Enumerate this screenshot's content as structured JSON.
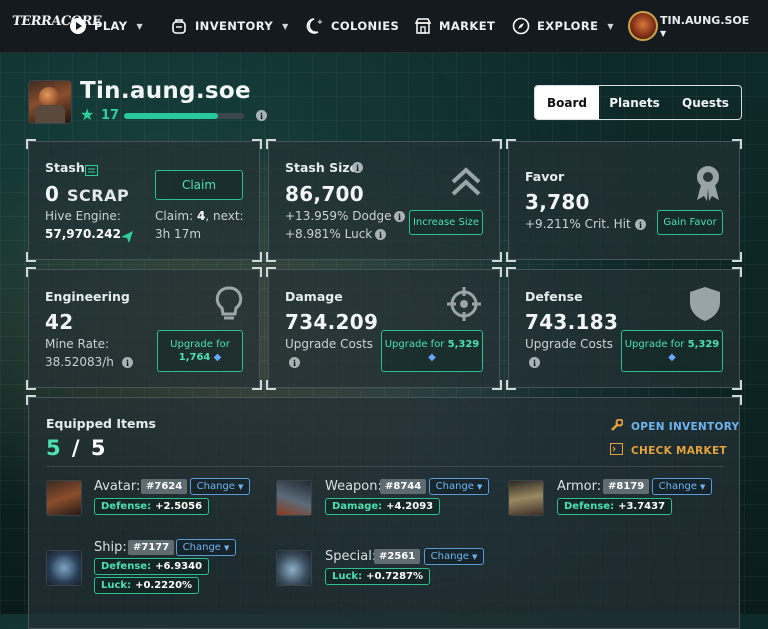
{
  "nav": {
    "logo": "TERRACORE",
    "play": "PLAY",
    "inventory": "INVENTORY",
    "colonies": "COLONIES",
    "market": "MARKET",
    "explore": "EXPLORE",
    "username": "TIN.AUNG.SOE"
  },
  "profile": {
    "name": "Tin.aung.soe",
    "level": "17",
    "xp_progress": 0.78
  },
  "tabs": [
    "Board",
    "Planets",
    "Quests"
  ],
  "stash": {
    "title": "Stash",
    "value": "0",
    "unit": "SCRAP",
    "engine_label": "Hive Engine:",
    "engine_value": "57,970.242",
    "claim_button": "Claim",
    "claim_label": "Claim:",
    "claim_count": "4",
    "next_label": ", next:",
    "next_time": "3h 17m"
  },
  "stash_size": {
    "title": "Stash Size",
    "value": "86,700",
    "dodge": "+13.959% Dodge",
    "luck": "+8.981% Luck",
    "button": "Increase Size"
  },
  "favor": {
    "title": "Favor",
    "value": "3,780",
    "crit": "+9.211% Crit. Hit",
    "button": "Gain Favor"
  },
  "engineering": {
    "title": "Engineering",
    "value": "42",
    "rate_label": "Mine Rate:",
    "rate_value": "38.52083/h",
    "button_text": "Upgrade for",
    "button_cost": "1,764"
  },
  "damage": {
    "title": "Damage",
    "value": "734.209",
    "costs_label": "Upgrade Costs",
    "button_text": "Upgrade for",
    "button_cost": "5,329"
  },
  "defense": {
    "title": "Defense",
    "value": "743.183",
    "costs_label": "Upgrade Costs",
    "button_text": "Upgrade for",
    "button_cost": "5,329"
  },
  "equipped": {
    "title": "Equipped Items",
    "count": "5",
    "total": "5",
    "open_inventory": "OPEN INVENTORY",
    "check_market": "CHECK MARKET",
    "change_label": "Change",
    "items": [
      {
        "slot": "Avatar:",
        "id": "#7624",
        "stats": [
          {
            "k": "Defense:",
            "v": "+2.5056"
          }
        ]
      },
      {
        "slot": "Weapon:",
        "id": "#8744",
        "stats": [
          {
            "k": "Damage:",
            "v": "+4.2093"
          }
        ]
      },
      {
        "slot": "Armor:",
        "id": "#8179",
        "stats": [
          {
            "k": "Defense:",
            "v": "+3.7437"
          }
        ]
      },
      {
        "slot": "Ship:",
        "id": "#7177",
        "stats": [
          {
            "k": "Defense:",
            "v": "+6.9340"
          },
          {
            "k": "Luck:",
            "v": "+0.2220%"
          }
        ]
      },
      {
        "slot": "Special:",
        "id": "#2561",
        "stats": [
          {
            "k": "Luck:",
            "v": "+0.7287%"
          }
        ]
      }
    ]
  },
  "colors": {
    "accent": "#4fe0b0",
    "link_blue": "#6fb4f0",
    "market_orange": "#e6a23c"
  }
}
